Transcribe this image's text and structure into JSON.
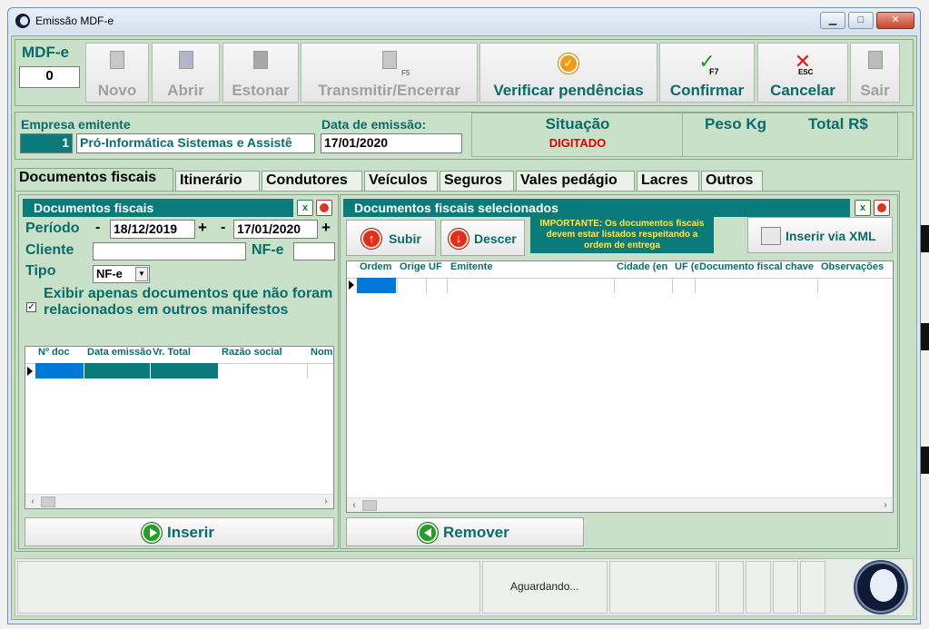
{
  "window": {
    "title": "Emissão MDF-e",
    "min": "▁",
    "max": "□",
    "close": "✕"
  },
  "mdfe": {
    "label": "MDF-e",
    "value": "0"
  },
  "toolbar": {
    "novo": "Novo",
    "abrir": "Abrir",
    "estonar": "Estonar",
    "transmitir": "Transmitir/Encerrar",
    "verificar": "Verificar pendências",
    "confirmar": "Confirmar",
    "cancelar": "Cancelar",
    "sair": "Sair",
    "confirmar_key": "F7",
    "cancelar_key": "ESC",
    "transmitir_key": "F5"
  },
  "header": {
    "empresa_label": "Empresa emitente",
    "empresa_code": "1",
    "empresa_name": "Pró-Informática Sistemas e Assistê",
    "data_label": "Data de emissão:",
    "data_value": "17/01/2020",
    "situacao_label": "Situação",
    "situacao_value": "DIGITADO",
    "peso_label": "Peso Kg",
    "total_label": "Total R$"
  },
  "colors": {
    "teal": "#0a7a7a",
    "status_red": "#e00000",
    "accent_green": "#c9e1c9"
  },
  "tabs": [
    "Documentos fiscais",
    "Itinerário",
    "Condutores",
    "Veículos",
    "Seguros",
    "Vales pedágio",
    "Lacres",
    "Outros"
  ],
  "left": {
    "title": "Documentos fiscais",
    "periodo_label": "Período",
    "date_from": "18/12/2019",
    "date_to": "17/01/2020",
    "minus": "-",
    "plus": "+",
    "cliente_label": "Cliente",
    "nfe_label": "NF-e",
    "tipo_label": "Tipo",
    "tipo_value": "NF-e",
    "checkbox_label": "Exibir apenas documentos que não foram relacionados em outros manifestos",
    "columns": [
      "Nº doc",
      "Data emissão",
      "Vr. Total",
      "Razão social",
      "Nome"
    ],
    "inserir": "Inserir"
  },
  "right": {
    "title": "Documentos fiscais selecionados",
    "subir": "Subir",
    "descer": "Descer",
    "importante": "IMPORTANTE: Os documentos fiscais devem estar listados respeitando a ordem de entrega",
    "inserir_xml": "Inserir via XML",
    "columns": [
      "Ordem",
      "Orige",
      "UF",
      "Emitente",
      "Cidade (en",
      "UF (e",
      "Documento fiscal chave",
      "Observações"
    ],
    "remover": "Remover"
  },
  "status": {
    "text": "Aguardando..."
  }
}
